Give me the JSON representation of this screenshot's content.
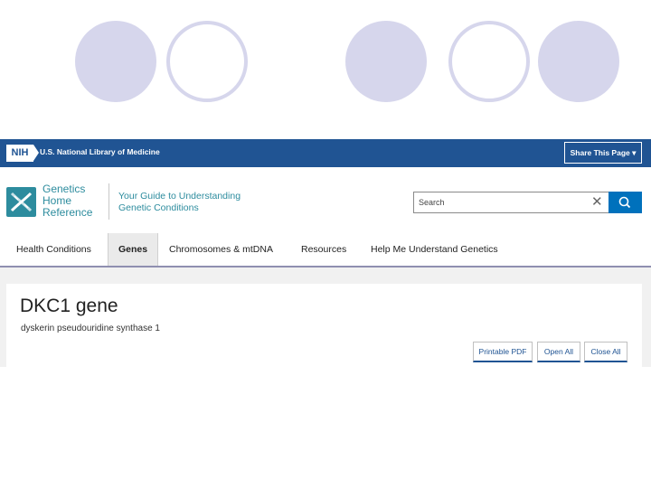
{
  "topbar": {
    "logo_text": "NIH",
    "org_name": "U.S. National Library of Medicine",
    "share_label": "Share This Page ▾"
  },
  "header": {
    "brand_lines": [
      "Genetics",
      "Home",
      "Reference"
    ],
    "tagline_lines": [
      "Your Guide to Understanding",
      "Genetic Conditions"
    ]
  },
  "search": {
    "placeholder": "Search",
    "clear_icon": "close-icon",
    "submit_icon": "search-icon"
  },
  "nav": {
    "items": [
      {
        "label": "Health Conditions"
      },
      {
        "label": "Genes"
      },
      {
        "label": "Chromosomes & mtDNA"
      },
      {
        "label": "Resources"
      },
      {
        "label": "Help Me Understand Genetics"
      }
    ],
    "active_index": 1
  },
  "gene": {
    "title": "DKC1 gene",
    "subtitle": "dyskerin pseudouridine synthase 1"
  },
  "actions": {
    "printable_pdf": "Printable PDF",
    "open_all": "Open All",
    "close_all": "Close All"
  },
  "colors": {
    "nih_blue": "#205493",
    "brand_teal": "#2d8c9e",
    "search_button": "#0071bc",
    "decor_circle": "#d6d6ec"
  }
}
